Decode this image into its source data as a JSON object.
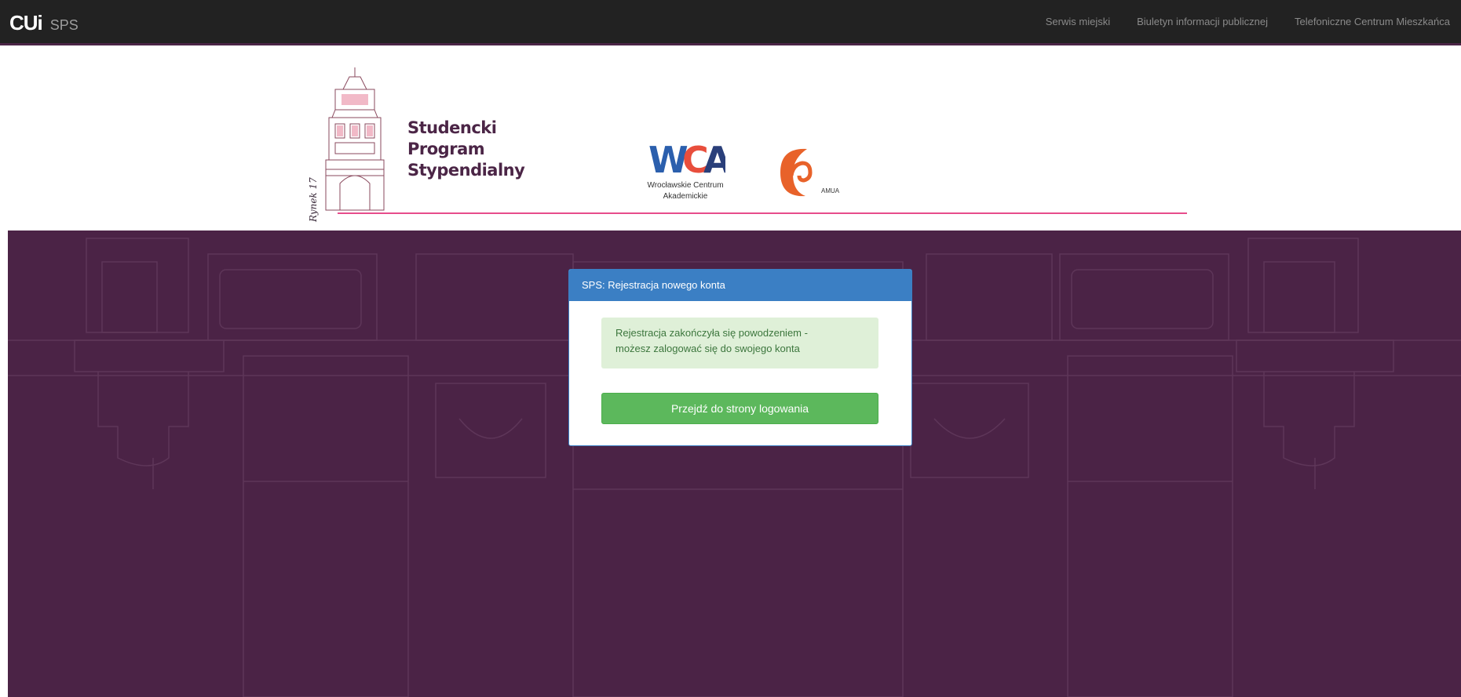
{
  "navbar": {
    "brand_logo": "CUi",
    "brand_name": "SPS",
    "links": [
      "Serwis miejski",
      "Biuletyn informacji publicznej",
      "Telefoniczne Centrum Mieszkańca"
    ]
  },
  "banner": {
    "sps_lines": [
      "Studencki",
      "Program",
      "Stypendialny"
    ],
    "signature": "Rynek 17",
    "wca_letters": "WCA",
    "wca_caption_lines": [
      "Wrocławskie Centrum",
      "Akademickie"
    ],
    "amua_label": "AMUA"
  },
  "panel": {
    "title": "SPS: Rejestracja nowego konta",
    "alert_lines": [
      "Rejestracja zakończyła się powodzeniem -",
      "możesz zalogować się do swojego konta"
    ],
    "button_label": "Przejdź do strony logowania"
  },
  "colors": {
    "main_bg": "#4b2346",
    "panel_heading": "#3b7fc4",
    "success_button": "#5cb85c",
    "alert_bg": "#dff0d8",
    "accent_line": "#e74c8b"
  }
}
